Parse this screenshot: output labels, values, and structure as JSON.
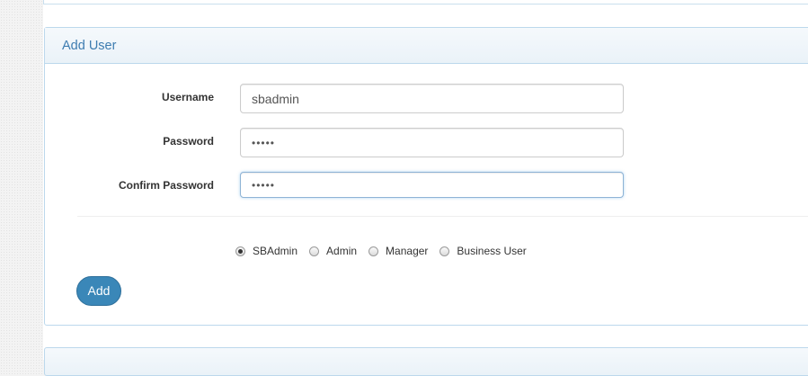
{
  "panel": {
    "title": "Add User"
  },
  "form": {
    "username": {
      "label": "Username",
      "value": "sbadmin"
    },
    "password": {
      "label": "Password",
      "value": "•••••"
    },
    "confirm_password": {
      "label": "Confirm Password",
      "value": "•••••"
    }
  },
  "roles": {
    "options": [
      {
        "label": "SBAdmin",
        "checked": true
      },
      {
        "label": "Admin",
        "checked": false
      },
      {
        "label": "Manager",
        "checked": false
      },
      {
        "label": "Business User",
        "checked": false
      }
    ]
  },
  "actions": {
    "add_label": "Add"
  },
  "colors": {
    "accent": "#3a87b8",
    "heading_text": "#3d7cb0",
    "panel_border": "#bcd8ec"
  }
}
